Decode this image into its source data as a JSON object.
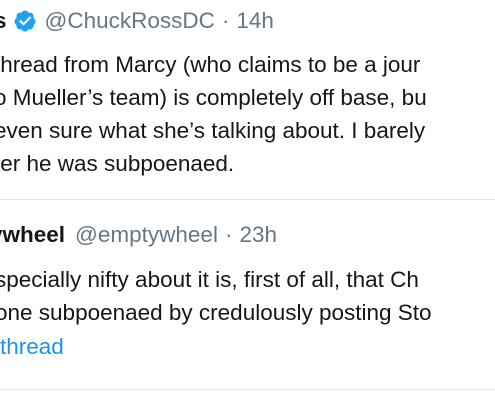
{
  "tweet1": {
    "display_name": "s",
    "handle": "@ChuckRossDC",
    "separator": "·",
    "time": "14h",
    "lines": [
      "thread from Marcy (who claims to be a jour",
      "o Mueller’s team) is completely off base, bu",
      "even sure what she’s talking about. I barely",
      "ter he was subpoenaed."
    ]
  },
  "tweet2": {
    "display_name": "ywheel",
    "handle": "@emptywheel",
    "separator": "·",
    "time": "23h",
    "lines": [
      "specially nifty about it is, first of all, that Ch",
      "one subpoenaed by credulously posting Sto"
    ],
    "thread_link": "thread"
  },
  "colors": {
    "text": "#14171a",
    "secondary": "#657786",
    "link": "#1b95e0",
    "verified": "#1da1f2",
    "divider": "#e1e8ed"
  },
  "icons": {
    "verified": "verified-badge-icon"
  }
}
